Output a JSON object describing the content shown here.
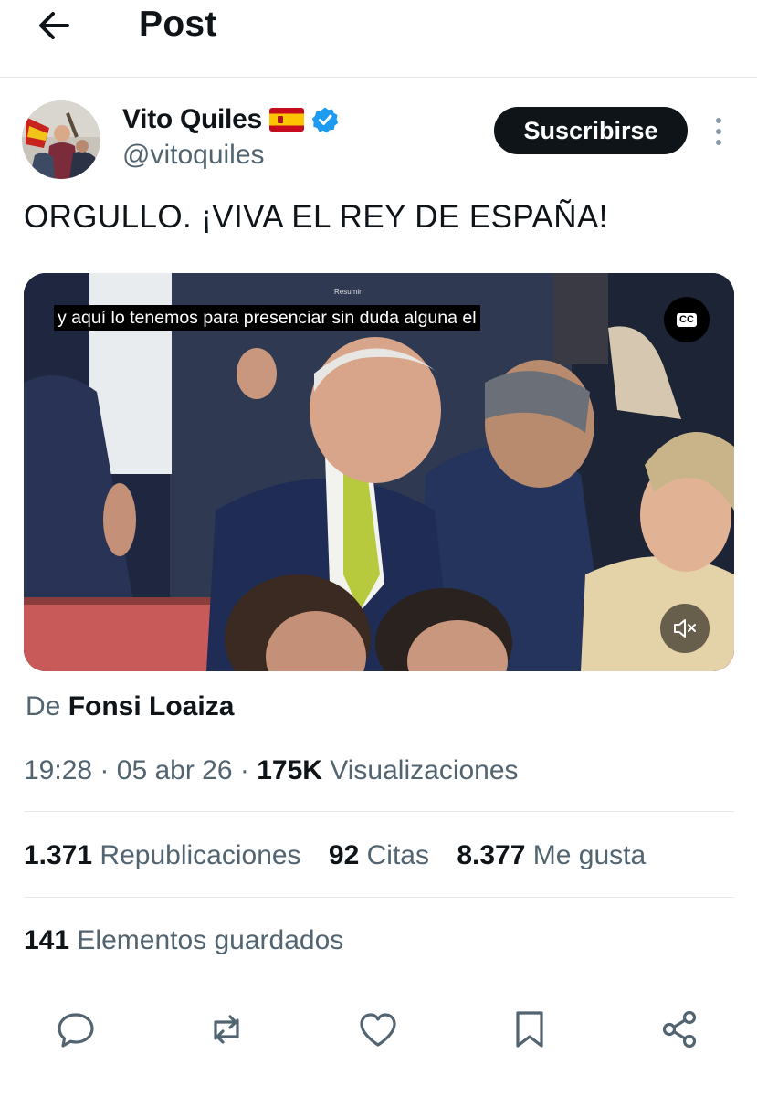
{
  "header": {
    "title": "Post",
    "back_icon": "arrow-left-icon"
  },
  "author": {
    "name": "Vito Quiles",
    "flag": "spain-flag-icon",
    "verified_icon": "verified-badge-icon",
    "handle": "@vitoquiles",
    "subscribe_label": "Suscribirse",
    "more_icon": "more-vertical-icon"
  },
  "tweet": {
    "text": "ORGULLO. ¡VIVA EL REY DE ESPAÑA!"
  },
  "video": {
    "caption": "y aquí lo tenemos para presenciar sin duda alguna el",
    "cc_label": "CC",
    "mini_label": "Resumir",
    "mute_icon": "volume-muted-icon"
  },
  "source": {
    "prefix": "De",
    "author": "Fonsi Loaiza"
  },
  "meta": {
    "time": "19:28",
    "date": "05 abr 26",
    "views_count": "175K",
    "views_label": "Visualizaciones",
    "sep": "·"
  },
  "stats": {
    "reposts_count": "1.371",
    "reposts_label": "Republicaciones",
    "quotes_count": "92",
    "quotes_label": "Citas",
    "likes_count": "8.377",
    "likes_label": "Me gusta",
    "saved_count": "141",
    "saved_label": "Elementos guardados"
  },
  "actions": [
    "reply-icon",
    "repost-icon",
    "like-icon",
    "bookmark-icon",
    "share-icon"
  ],
  "colors": {
    "text": "#0f1419",
    "secondary": "#536471",
    "verified": "#1d9bf0",
    "button": "#0f1419",
    "divider": "#e6e9ec"
  }
}
